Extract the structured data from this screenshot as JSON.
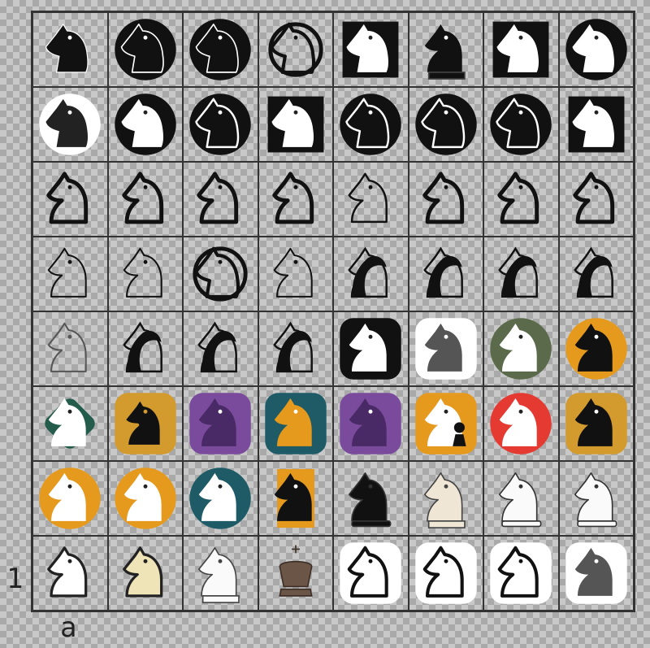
{
  "board": {
    "rank_label": "1",
    "file_label": "a",
    "rows": [
      [
        "knight-geometric-icon",
        "knight-black-disc-icon",
        "knight-black-disc-swirl-icon",
        "knight-outline-circle-icon",
        "knight-black-rounded-square-icon",
        "knight-black-statuette-icon",
        "knight-white-on-black-square-icon",
        "knight-white-in-black-disc-icon"
      ],
      [
        "knight-black-in-white-disc-icon",
        "knight-white-in-black-disc-icon",
        "knight-black-head-on-disc-icon",
        "knight-white-cutout-square-icon",
        "knight-ornate-emblem-icon",
        "knight-spiral-mane-emblem-icon",
        "knight-double-pair-icon",
        "knight-arrow-square-icon"
      ],
      [
        "knight-outline-bold-icon",
        "knight-outline-bold-icon",
        "knight-outline-bold-icon",
        "knight-outline-bold-icon",
        "knight-outline-thin-icon",
        "knight-outline-striped-icon",
        "knight-outline-striped-icon",
        "knight-outline-striped-icon"
      ],
      [
        "knight-sketch-icon",
        "knight-sketch-icon",
        "knight-outline-circle-icon",
        "knight-sketch-icon",
        "knight-curve-icon",
        "knight-curve-icon",
        "knight-curve-icon",
        "knight-curve-icon"
      ],
      [
        "knight-sketch-grey-icon",
        "knight-curve-icon",
        "knight-curve-icon",
        "knight-curve-icon",
        "knight-white-on-black-tile-icon",
        "knight-grey-on-white-tile-icon",
        "knight-multicolor-disc-icon",
        "knight-black-on-orange-disc-icon"
      ],
      [
        "knight-white-on-green-rhombus-icon",
        "knight-gold-on-black-tile-icon",
        "knight-purple-tile-icon",
        "knight-orange-on-teal-tile-icon",
        "knight-purple-blob-icon",
        "knight-and-pawn-orange-tile-icon",
        "knight-white-on-red-disc-icon",
        "knight-black-on-gold-tile-icon"
      ],
      [
        "knight-white-on-orange-disc-icon",
        "knight-white-on-orange-disc-icon",
        "knight-white-on-teal-disc-icon",
        "knight-black-on-orange-card-icon",
        "knight-black-3d-icon",
        "knight-cream-statuette-icon",
        "knight-white-3d-icon",
        "knight-white-3d-icon"
      ],
      [
        "knight-white-flat-icon",
        "knight-cream-flat-icon",
        "knight-white-statuette-icon",
        "king-brown-icon",
        "knight-outline-on-white-tile-icon",
        "knight-outline-on-white-tile-icon",
        "knight-outline-on-white-tile-icon",
        "knight-grey-on-white-tile-icon"
      ]
    ]
  }
}
